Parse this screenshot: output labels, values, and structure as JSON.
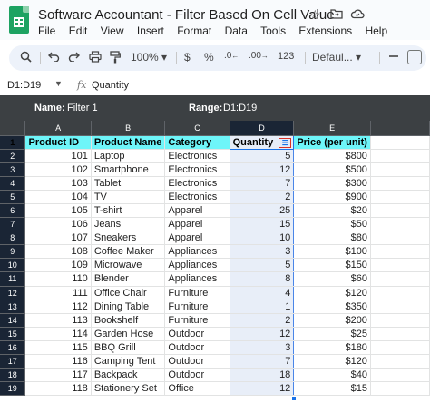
{
  "app": {
    "title": "Software Accountant - Filter Based On Cell Value",
    "icons": [
      "star-icon",
      "move-to-folder-icon",
      "cloud-status-icon"
    ],
    "menu": [
      "File",
      "Edit",
      "View",
      "Insert",
      "Format",
      "Data",
      "Tools",
      "Extensions",
      "Help"
    ]
  },
  "toolbar": {
    "zoom": "100%",
    "currency": "$",
    "percent": "%",
    "decrease_decimal": ".0",
    "increase_decimal": ".00",
    "number_format": "123",
    "font": "Defaul..."
  },
  "formula_bar": {
    "name_box": "D1:D19",
    "fx": "fx",
    "content": "Quantity"
  },
  "filter_bar": {
    "name_label": "Name:",
    "name_value": "Filter 1",
    "range_label": "Range:",
    "range_value": "D1:D19"
  },
  "sheet": {
    "columns": [
      "A",
      "B",
      "C",
      "D",
      "E"
    ],
    "selected_column": "D",
    "row_numbers": [
      "1",
      "2",
      "3",
      "4",
      "5",
      "6",
      "7",
      "8",
      "9",
      "10",
      "11",
      "12",
      "13",
      "14",
      "15",
      "16",
      "17",
      "18",
      "19"
    ],
    "headers": [
      "Product ID",
      "Product Name",
      "Category",
      "Quantity",
      "Price (per unit)"
    ],
    "header_fill": "#6ef5f9",
    "rows": [
      [
        "101",
        "Laptop",
        "Electronics",
        "5",
        "$800"
      ],
      [
        "102",
        "Smartphone",
        "Electronics",
        "12",
        "$500"
      ],
      [
        "103",
        "Tablet",
        "Electronics",
        "7",
        "$300"
      ],
      [
        "104",
        "TV",
        "Electronics",
        "2",
        "$900"
      ],
      [
        "105",
        "T-shirt",
        "Apparel",
        "25",
        "$20"
      ],
      [
        "106",
        "Jeans",
        "Apparel",
        "15",
        "$50"
      ],
      [
        "107",
        "Sneakers",
        "Apparel",
        "10",
        "$80"
      ],
      [
        "108",
        "Coffee Maker",
        "Appliances",
        "3",
        "$100"
      ],
      [
        "109",
        "Microwave",
        "Appliances",
        "5",
        "$150"
      ],
      [
        "110",
        "Blender",
        "Appliances",
        "8",
        "$60"
      ],
      [
        "111",
        "Office Chair",
        "Furniture",
        "4",
        "$120"
      ],
      [
        "112",
        "Dining Table",
        "Furniture",
        "1",
        "$350"
      ],
      [
        "113",
        "Bookshelf",
        "Furniture",
        "2",
        "$200"
      ],
      [
        "114",
        "Garden Hose",
        "Outdoor",
        "12",
        "$25"
      ],
      [
        "115",
        "BBQ Grill",
        "Outdoor",
        "3",
        "$180"
      ],
      [
        "116",
        "Camping Tent",
        "Outdoor",
        "7",
        "$120"
      ],
      [
        "117",
        "Backpack",
        "Outdoor",
        "18",
        "$40"
      ],
      [
        "118",
        "Stationery Set",
        "Office",
        "12",
        "$15"
      ]
    ]
  }
}
